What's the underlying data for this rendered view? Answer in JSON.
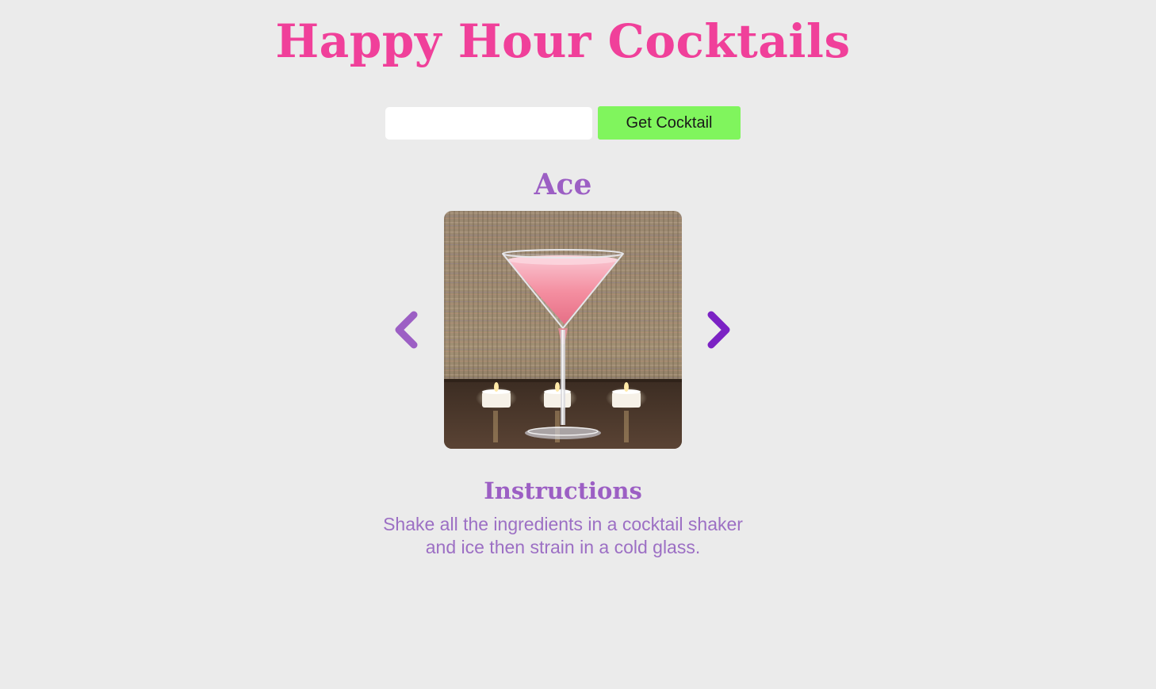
{
  "app": {
    "title": "Happy Hour Cocktails"
  },
  "search": {
    "value": "",
    "placeholder": "",
    "button_label": "Get Cocktail"
  },
  "cocktail": {
    "name": "Ace",
    "image_icon": "cocktail-photo",
    "instructions_heading": "Instructions",
    "instructions": "Shake all the ingredients in a cocktail shaker and ice then strain in a cold glass."
  },
  "navigation": {
    "previous_icon": "chevron-left-icon",
    "next_icon": "chevron-right-icon"
  },
  "colors": {
    "background": "#ebebeb",
    "title": "#f0409a",
    "accent_purple": "#9c5fc4",
    "next_arrow": "#7b22c4",
    "button": "#80f55d"
  }
}
